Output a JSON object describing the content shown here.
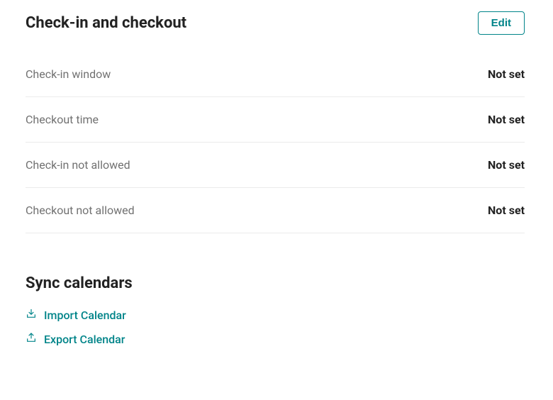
{
  "checkin_checkout": {
    "title": "Check-in and checkout",
    "edit_label": "Edit",
    "rows": [
      {
        "label": "Check-in window",
        "value": "Not set"
      },
      {
        "label": "Checkout time",
        "value": "Not set"
      },
      {
        "label": "Check-in not allowed",
        "value": "Not set"
      },
      {
        "label": "Checkout not allowed",
        "value": "Not set"
      }
    ]
  },
  "sync": {
    "title": "Sync calendars",
    "import_label": "Import Calendar",
    "export_label": "Export Calendar"
  }
}
